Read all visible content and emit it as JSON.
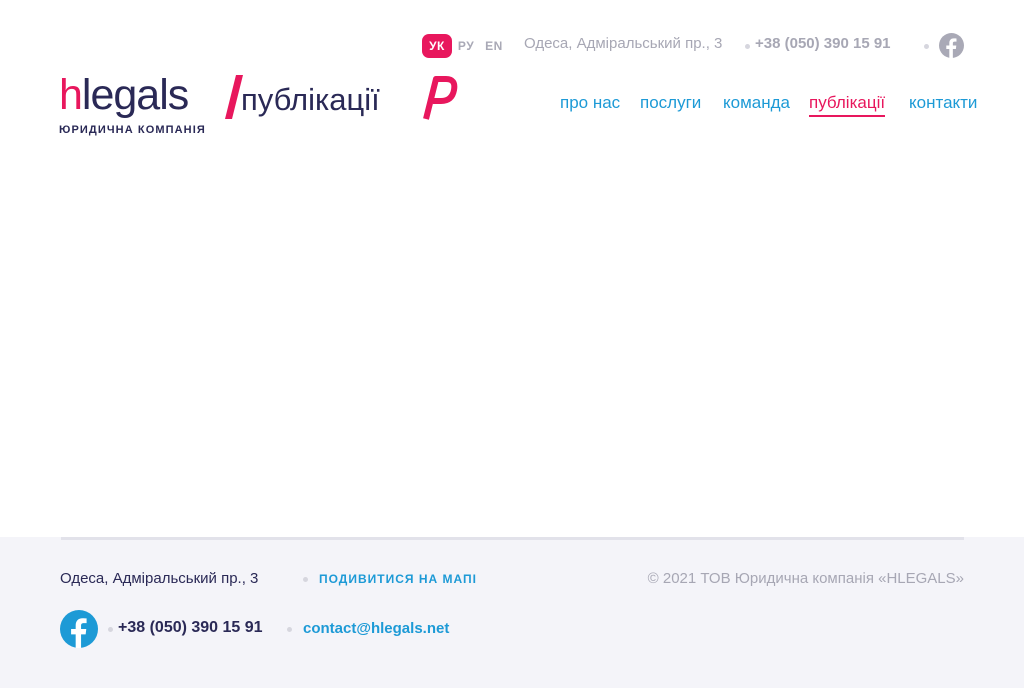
{
  "header": {
    "languages": [
      {
        "code": "УК",
        "active": true
      },
      {
        "code": "РУ",
        "active": false
      },
      {
        "code": "EN",
        "active": false
      }
    ],
    "address": "Одеса, Адміральський пр., 3",
    "phone": "+38 (050) 390 15 91",
    "social_icon": "facebook-icon"
  },
  "logo": {
    "brand_first": "h",
    "brand_rest": "legals",
    "section": "публікації",
    "subtitle": "ЮРИДИЧНА КОМПАНІЯ"
  },
  "nav": {
    "items": [
      {
        "label": "про нас",
        "active": false
      },
      {
        "label": "послуги",
        "active": false
      },
      {
        "label": "команда",
        "active": false
      },
      {
        "label": "публікації",
        "active": true
      },
      {
        "label": "контакти",
        "active": false
      }
    ]
  },
  "footer": {
    "address": "Одеса, Адміральський пр., 3",
    "map_link": "ПОДИВИТИСЯ НА МАПІ",
    "copyright": "© 2021 ТОВ Юридична компанія «HLEGALS»",
    "phone": "+38 (050) 390 15 91",
    "email": "contact@hlegals.net",
    "social_icon": "facebook-icon"
  },
  "colors": {
    "accent": "#e8175d",
    "link": "#1d9ad6",
    "text_dark": "#2a2956",
    "muted": "#a7a7b4",
    "footer_bg": "#f4f4f9"
  }
}
